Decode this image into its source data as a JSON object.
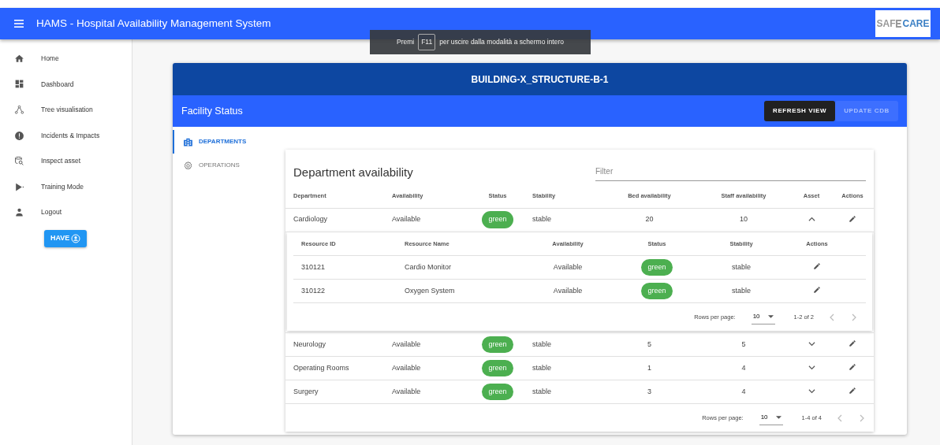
{
  "app_bar": {
    "title": "HAMS - Hospital Availability Management System",
    "logo": {
      "left": "SAF",
      "right": "CARE"
    }
  },
  "sidebar": {
    "items": [
      {
        "label": "Home",
        "kind": "home"
      },
      {
        "label": "Dashboard",
        "kind": "dashboard"
      },
      {
        "label": "Tree visualisation",
        "kind": "tree"
      },
      {
        "label": "Incidents & Impacts",
        "kind": "alert"
      },
      {
        "label": "Inspect asset",
        "kind": "inspect"
      },
      {
        "label": "Training Mode",
        "kind": "play"
      },
      {
        "label": "Logout",
        "kind": "person"
      }
    ],
    "button": "HAVE"
  },
  "fullscreen_notice": {
    "before": "Premi",
    "key_label": "F11",
    "after": "per uscire dalla modalità a schermo intero"
  },
  "panel": {
    "building": "BUILDING-X_STRUCTURE-B-1",
    "title": "Facility Status",
    "buttons": [
      {
        "label": "REFRESH VIEW",
        "disabled": false
      },
      {
        "label": "UPDATE CDB",
        "disabled": true
      }
    ],
    "tabs": [
      {
        "label": "DEPARTMENTS",
        "kind": "building",
        "selected": true
      },
      {
        "label": "OPERATIONS",
        "kind": "gear",
        "selected": false
      }
    ]
  },
  "departments": {
    "title": "Department availability",
    "filter": {
      "placeholder": "Filter"
    },
    "columns": [
      "Department",
      "Availability",
      "Status",
      "Stability",
      "Bed availability",
      "Staff availability",
      "Asset",
      "Actions"
    ],
    "rows": [
      {
        "department": "Cardiology",
        "availability": "Available",
        "status": "green",
        "color": "#4caf50",
        "stability": "stable",
        "beds": "20",
        "staff": "10",
        "expanded": true,
        "assets": {
          "columns": [
            "Resource ID",
            "Resource Name",
            "Availability",
            "Status",
            "Stability",
            "Actions"
          ],
          "rows": [
            {
              "id": "310121",
              "name": "Cardio Monitor",
              "availability": "Available",
              "status": "green",
              "color": "#4caf50",
              "stability": "stable"
            },
            {
              "id": "310122",
              "name": "Oxygen System",
              "availability": "Available",
              "status": "green",
              "color": "#4caf50",
              "stability": "stable"
            }
          ],
          "pagination": {
            "label": "Rows per page:",
            "per_page": "10",
            "range": "1-2 of 2"
          }
        }
      },
      {
        "department": "Neurology",
        "availability": "Available",
        "status": "green",
        "color": "#4caf50",
        "stability": "stable",
        "beds": "5",
        "staff": "5",
        "expanded": false
      },
      {
        "department": "Operating Rooms",
        "availability": "Available",
        "status": "green",
        "color": "#4caf50",
        "stability": "stable",
        "beds": "1",
        "staff": "4",
        "expanded": false
      },
      {
        "department": "Surgery",
        "availability": "Available",
        "status": "green",
        "color": "#4caf50",
        "stability": "stable",
        "beds": "3",
        "staff": "4",
        "expanded": false
      }
    ],
    "pagination": {
      "label": "Rows per page:",
      "per_page": "10",
      "range": "1-4 of 4"
    }
  }
}
